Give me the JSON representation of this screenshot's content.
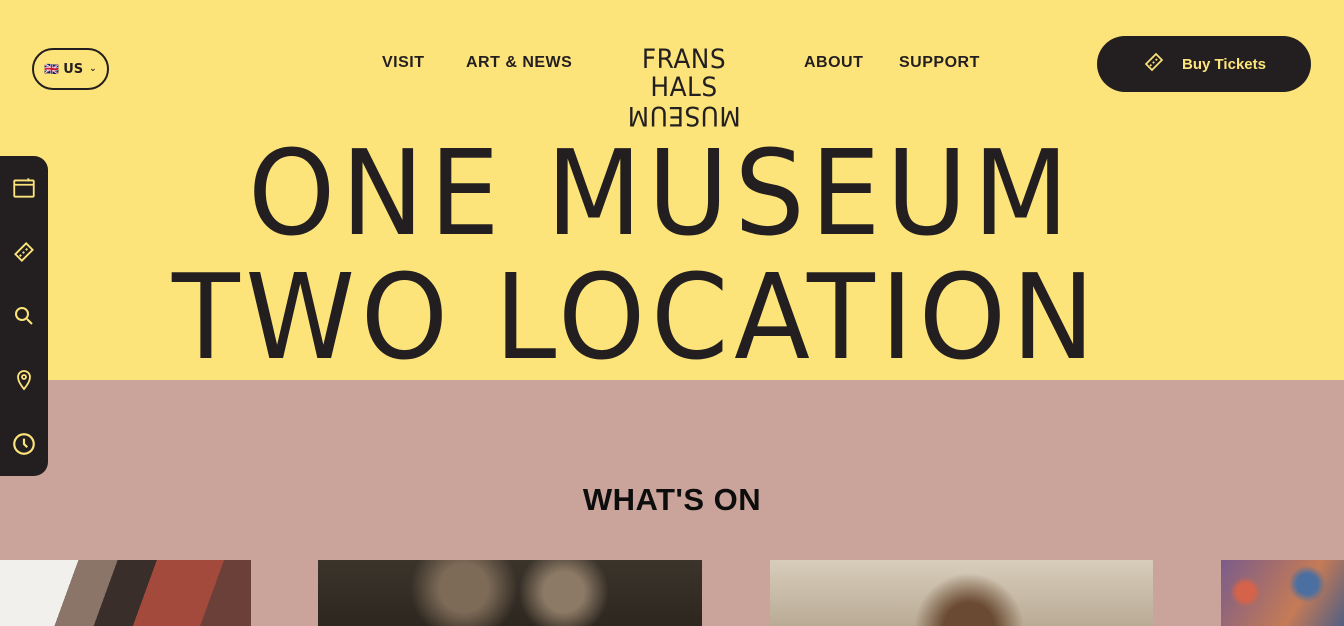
{
  "language": {
    "flag": "🇬🇧",
    "label": "US"
  },
  "nav": {
    "visit": "VISIT",
    "art_news": "ART & NEWS",
    "about": "ABOUT",
    "support": "SUPPORT"
  },
  "logo": {
    "line1": "FRANS HALS",
    "line2": "MUSEUM"
  },
  "buy_tickets": "Buy Tickets",
  "hero": {
    "line1": "ONE MUSEUM",
    "line2": "TWO LOCATION"
  },
  "section_title": "WHAT'S ON",
  "sidebar": [
    "calendar-icon",
    "ticket-icon",
    "search-icon",
    "location-pin-icon",
    "clock-icon"
  ],
  "colors": {
    "yellow": "#fde47a",
    "pink": "#caa49a",
    "dark": "#231f20"
  }
}
